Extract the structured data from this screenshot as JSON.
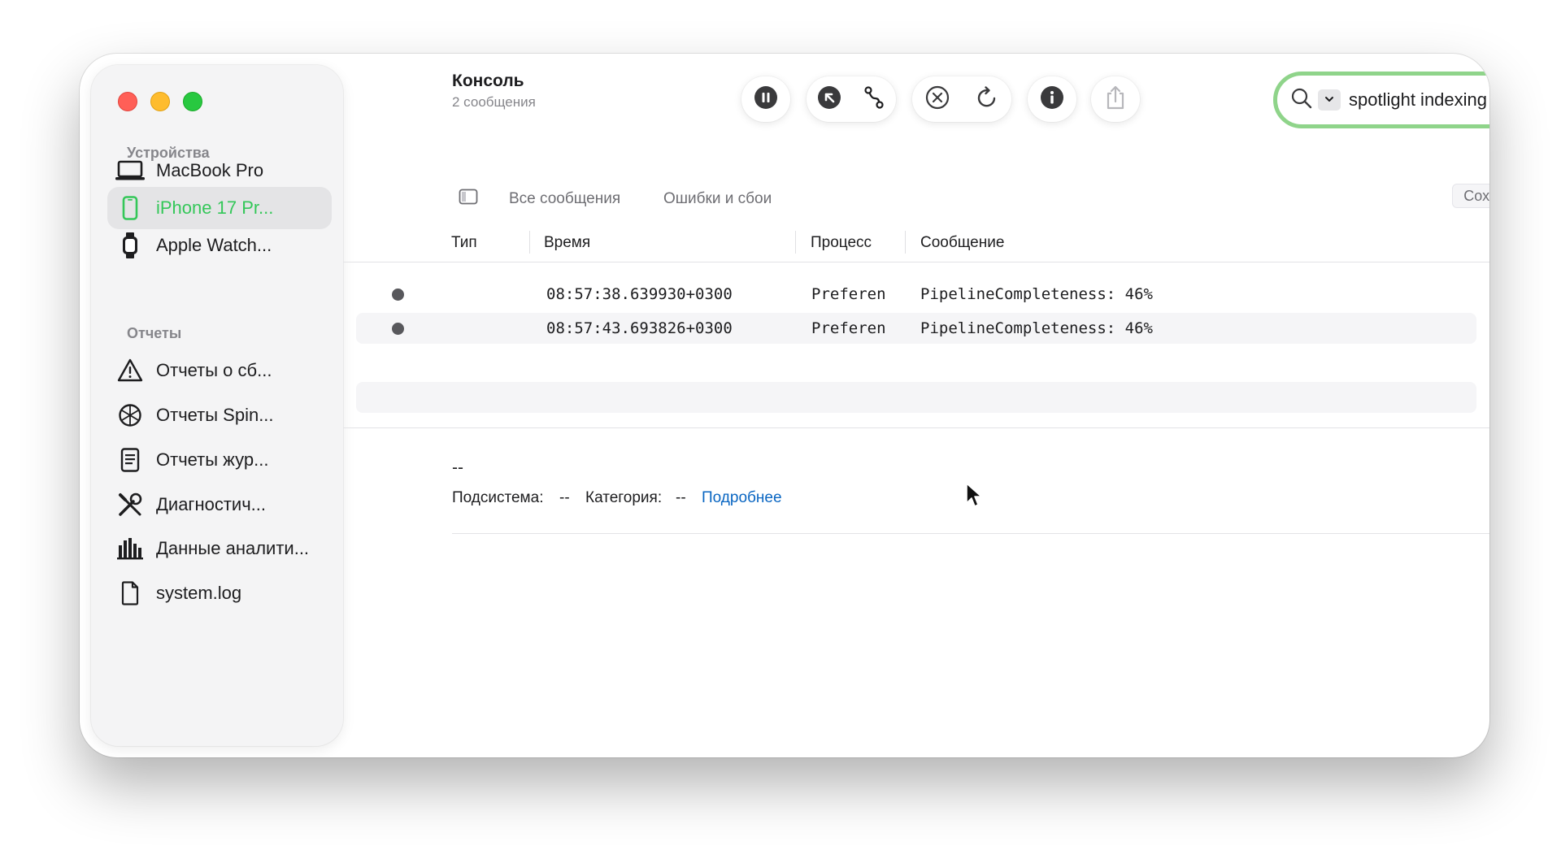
{
  "window": {
    "title": "Консоль",
    "subtitle": "2 сообщения"
  },
  "sidebar": {
    "devices_title": "Устройства",
    "devices": [
      {
        "label": "MacBook Pro",
        "icon": "laptop-icon"
      },
      {
        "label": "iPhone 17 Pr...",
        "icon": "iphone-icon",
        "selected": true
      },
      {
        "label": "Apple Watch...",
        "icon": "watch-icon"
      }
    ],
    "reports_title": "Отчеты",
    "reports": [
      {
        "label": "Отчеты о сб...",
        "icon": "warning-icon"
      },
      {
        "label": "Отчеты Spin...",
        "icon": "spin-icon"
      },
      {
        "label": "Отчеты жур...",
        "icon": "document-list-icon"
      },
      {
        "label": "Диагностич...",
        "icon": "tools-icon"
      },
      {
        "label": "Данные аналити...",
        "icon": "bar-chart-icon"
      },
      {
        "label": "system.log",
        "icon": "file-icon"
      }
    ]
  },
  "toolbar": {
    "pause": "pause-icon",
    "activities": "arrow-up-left-icon",
    "path": "path-icon",
    "clear": "clear-icon",
    "reload": "reload-icon",
    "info": "info-icon",
    "share": "share-icon"
  },
  "search": {
    "value": "spotlight indexing pro..."
  },
  "filters": {
    "all": "Все сообщения",
    "errors": "Ошибки и сбои",
    "save": "Сохранить"
  },
  "table": {
    "columns": [
      "Тип",
      "Время",
      "Процесс",
      "Сообщение"
    ],
    "rows": [
      {
        "time": "08:57:38.639930+0300",
        "process": "Preferen",
        "message": "PipelineCompleteness: 46%"
      },
      {
        "time": "08:57:43.693826+0300",
        "process": "Preferen",
        "message": "PipelineCompleteness: 46%"
      }
    ]
  },
  "detail": {
    "dash": "--",
    "subsystem_label": "Подсистема:",
    "subsystem_value": "--",
    "category_label": "Категория:",
    "category_value": "--",
    "more_link": "Подробнее",
    "right_value": "--"
  },
  "colors": {
    "accent_green": "#34c759",
    "search_ring": "#8fd48a",
    "link_blue": "#0a66c2"
  }
}
